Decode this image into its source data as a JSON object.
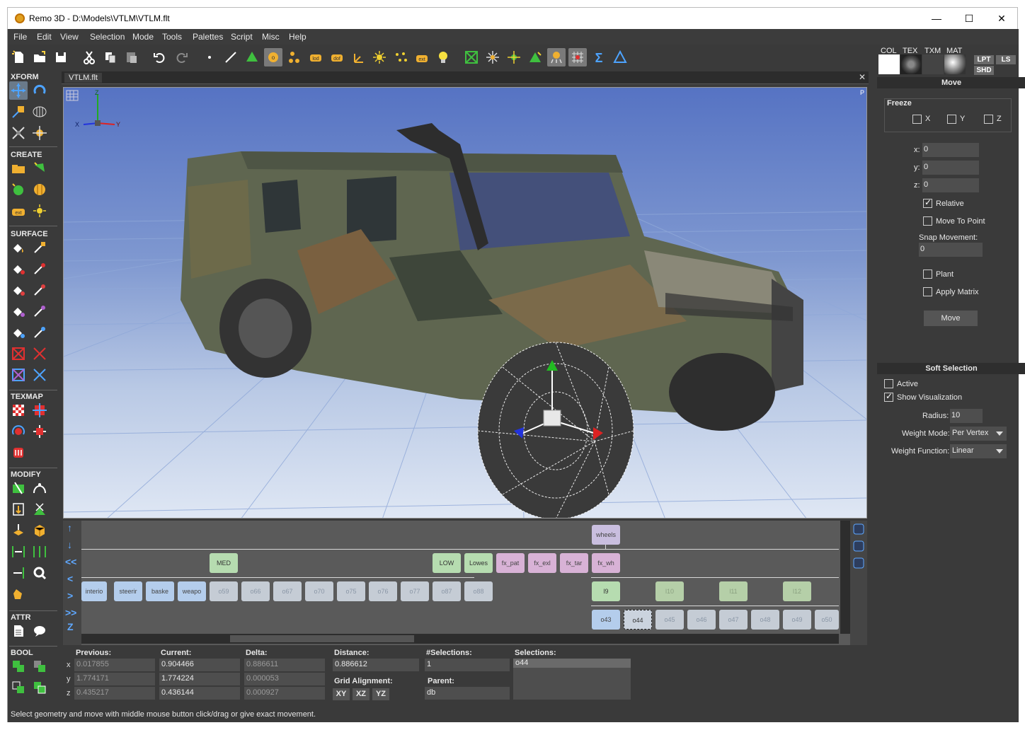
{
  "window": {
    "title": "Remo 3D - D:\\Models\\VTLM\\VTLM.flt",
    "minimize": "—",
    "maximize": "☐",
    "close": "✕"
  },
  "menu": [
    "File",
    "Edit",
    "View",
    "Selection",
    "Mode",
    "Tools",
    "Palettes",
    "Script",
    "Misc",
    "Help"
  ],
  "palette_sections": {
    "xform": "XFORM",
    "create": "CREATE",
    "surface": "SURFACE",
    "texmap": "TEXMAP",
    "modify": "MODIFY",
    "attr": "ATTR",
    "bool": "BOOL"
  },
  "viewport": {
    "tab": "VTLM.flt",
    "close": "✕",
    "corner": "P",
    "axis_z": "Z",
    "axis_x": "X",
    "axis_y": "Y"
  },
  "graph": {
    "nav": [
      "↑",
      "↓",
      "<<",
      "<",
      ">",
      ">>",
      "Z"
    ],
    "nodes": {
      "wheels": "wheels",
      "med": "MED",
      "low": "LOW",
      "lowes": "Lowes",
      "fx_pat": "fx_pat",
      "fx_exl": "fx_exl",
      "fx_tar": "fx_tar",
      "fx_wh": "fx_wh",
      "interio": "interio",
      "steerin": "steerir",
      "basket": "baske",
      "weapon": "weapo",
      "o59": "o59",
      "o66": "o66",
      "o67": "o67",
      "o70": "o70",
      "o75": "o75",
      "o76": "o76",
      "o77": "o77",
      "o87": "o87",
      "o88": "o88",
      "l9": "l9",
      "l10": "l10",
      "l11": "l11",
      "l12": "l12",
      "o43": "o43",
      "o44": "o44",
      "o45": "o45",
      "o46": "o46",
      "o47": "o47",
      "o48": "o48",
      "o49": "o49",
      "o50": "o50"
    }
  },
  "info": {
    "previous_label": "Previous:",
    "current_label": "Current:",
    "delta_label": "Delta:",
    "distance_label": "Distance:",
    "nsel_label": "#Selections:",
    "sel_label": "Selections:",
    "grid_label": "Grid Alignment:",
    "parent_label": "Parent:",
    "axes": [
      "x",
      "y",
      "z"
    ],
    "previous": [
      "0.017855",
      "1.774171",
      "0.435217"
    ],
    "current": [
      "0.904466",
      "1.774224",
      "0.436144"
    ],
    "delta": [
      "0.886611",
      "0.000053",
      "0.000927"
    ],
    "distance": "0.886612",
    "nsel": "1",
    "selection": "o44",
    "parent": "db",
    "grid_buttons": [
      "XY",
      "XZ",
      "YZ"
    ]
  },
  "status": "Select geometry and move with middle mouse button click/drag or give exact movement.",
  "right": {
    "swatch_labels": [
      "COL",
      "TEX",
      "TXM",
      "MAT"
    ],
    "lpt": "LPT",
    "ls": "LS",
    "shd": "SHD",
    "move_header": "Move",
    "freeze": "Freeze",
    "fx": "X",
    "fy": "Y",
    "fz": "Z",
    "x_label": "x:",
    "y_label": "y:",
    "z_label": "z:",
    "x_val": "0",
    "y_val": "0",
    "z_val": "0",
    "relative": "Relative",
    "move_to_point": "Move To Point",
    "snap_label": "Snap Movement:",
    "snap_val": "0",
    "plant": "Plant",
    "apply_matrix": "Apply Matrix",
    "move_button": "Move",
    "soft_header": "Soft Selection",
    "active": "Active",
    "show_vis": "Show Visualization",
    "radius_label": "Radius:",
    "radius_val": "10",
    "weight_mode_label": "Weight Mode:",
    "weight_mode_val": "Per Vertex",
    "weight_fn_label": "Weight Function:",
    "weight_fn_val": "Linear"
  },
  "icons": {
    "toolbar": [
      "new-file-icon",
      "open-file-icon",
      "save-icon",
      "cut-icon",
      "copy-icon",
      "paste-icon",
      "undo-icon",
      "redo-icon",
      "select-vertex-icon",
      "select-edge-icon",
      "select-face-icon",
      "select-object-icon",
      "select-group-icon",
      "select-lod-icon",
      "select-dof-icon",
      "select-axis-icon",
      "select-light-icon",
      "select-lightpoint-icon",
      "select-external-icon",
      "select-bulb-icon",
      "select-all-icon",
      "explode-icon",
      "move-pivot-icon",
      "align-icon",
      "soft-select-icon",
      "grid-select-icon",
      "sigma-icon",
      "delta-icon"
    ]
  },
  "colors": {
    "background": "#3a3a3a",
    "accent": "#5fa8ff"
  }
}
